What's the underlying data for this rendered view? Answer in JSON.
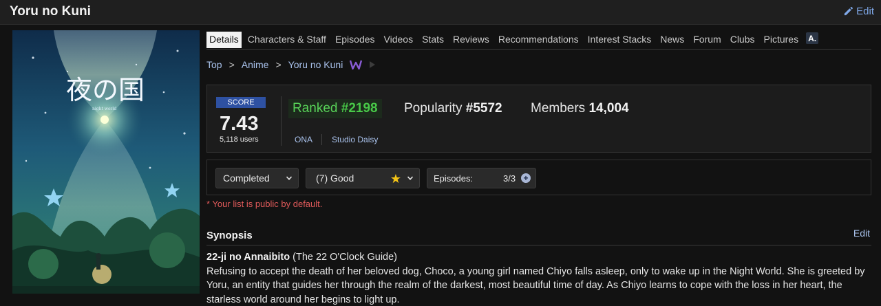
{
  "header": {
    "title": "Yoru no Kuni",
    "edit_label": "Edit",
    "edit_icon": "pencil-icon"
  },
  "poster": {
    "title_jp": "夜の国",
    "subtitle": "night world"
  },
  "tabs": [
    {
      "label": "Details",
      "active": true
    },
    {
      "label": "Characters & Staff"
    },
    {
      "label": "Episodes"
    },
    {
      "label": "Videos"
    },
    {
      "label": "Stats"
    },
    {
      "label": "Reviews"
    },
    {
      "label": "Recommendations"
    },
    {
      "label": "Interest Stacks"
    },
    {
      "label": "News"
    },
    {
      "label": "Forum"
    },
    {
      "label": "Clubs"
    },
    {
      "label": "Pictures"
    }
  ],
  "anilist_badge": "A.",
  "breadcrumb": {
    "top": "Top",
    "anime": "Anime",
    "current": "Yoru no Kuni",
    "separator": ">"
  },
  "score": {
    "label": "SCORE",
    "value": "7.43",
    "users": "5,118 users",
    "ranked_prefix": "Ranked",
    "ranked_value": "#2198",
    "popularity_prefix": "Popularity",
    "popularity_value": "#5572",
    "members_prefix": "Members",
    "members_value": "14,004",
    "type": "ONA",
    "studio": "Studio Daisy"
  },
  "list": {
    "status": "Completed",
    "rating": "(7) Good",
    "episodes_label": "Episodes:",
    "episodes_value": "3/3",
    "public_note": "* Your list is public by default."
  },
  "synopsis": {
    "heading": "Synopsis",
    "edit_label": "Edit",
    "title_romaji": "22-ji no Annaibito",
    "title_en": "(The 22 O'Clock Guide)",
    "text": "Refusing to accept the death of her beloved dog, Choco, a young girl named Chiyo falls asleep, only to wake up in the Night World. She is greeted by Yoru, an entity that guides her through the realm of the darkest, most beautiful time of day. As Chiyo learns to cope with the loss in her heart, the starless world around her begins to light up."
  },
  "colors": {
    "link": "#a9c2ec",
    "score_label_bg": "#2e51a2",
    "ranked": "#48c848",
    "warning": "#e05a5a"
  }
}
